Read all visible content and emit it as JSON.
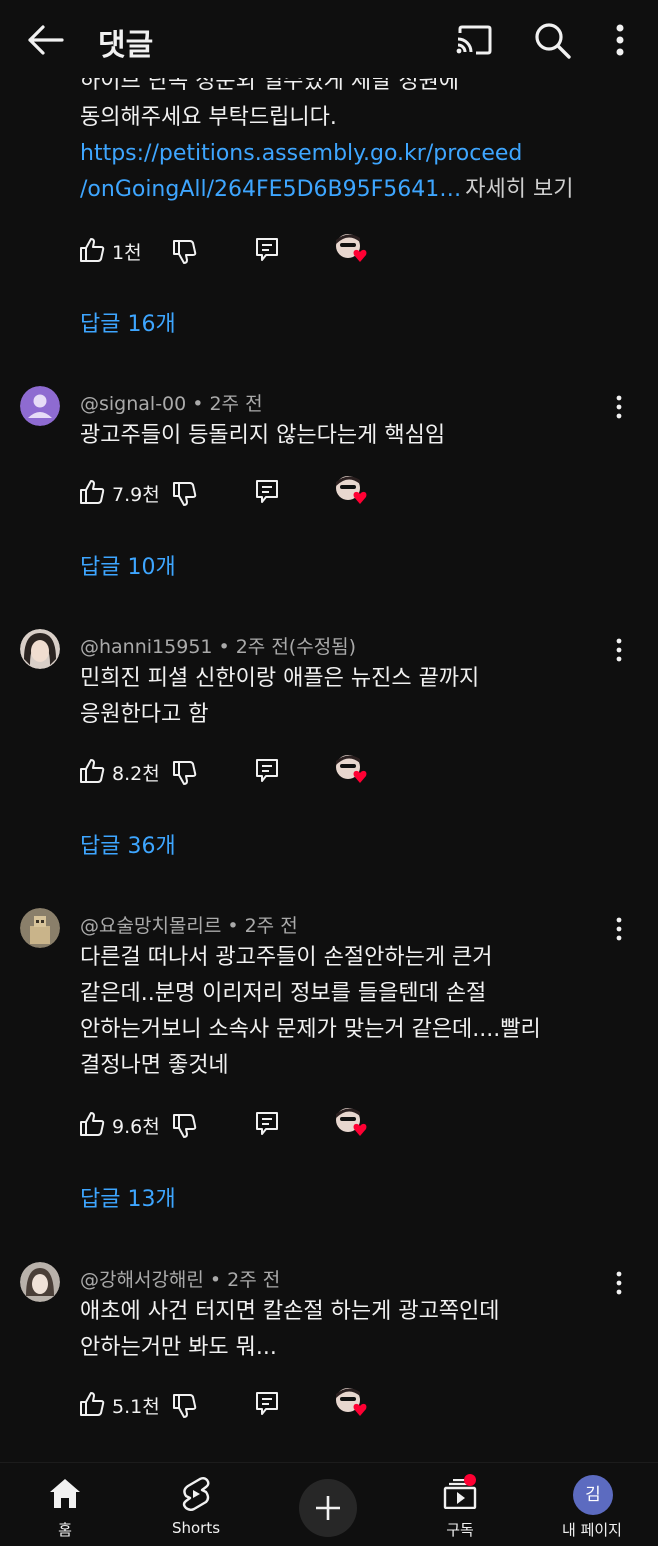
{
  "header": {
    "title": "댓글",
    "icons": [
      "back-arrow-icon",
      "cast-icon",
      "search-icon",
      "more-vert-icon"
    ]
  },
  "comments": [
    {
      "lines": [
        "하이브 단독 정문외 열수있게 세발 정원에",
        "동의해주세요 부탁드립니다."
      ],
      "link_lines": [
        "https://petitions.assembly.go.kr/proceed",
        "/onGoingAll/264FE5D6B95F5641…"
      ],
      "read_more": "자세히 보기",
      "likes": "1천",
      "replies": "답글 16개"
    },
    {
      "author": "@signal-00",
      "time": "2주 전",
      "lines": [
        "광고주들이 등돌리지 않는다는게 핵심임"
      ],
      "likes": "7.9천",
      "replies": "답글 10개"
    },
    {
      "author": "@hanni15951",
      "time": "2주 전(수정됨)",
      "lines": [
        "민희진 피셜 신한이랑 애플은 뉴진스 끝까지",
        "응원한다고 함"
      ],
      "likes": "8.2천",
      "replies": "답글 36개"
    },
    {
      "author": "@요술망치몰리르",
      "time": "2주 전",
      "lines": [
        "다른걸 떠나서 광고주들이 손절안하는게 큰거",
        "같은데..분명 이리저리 정보를 들을텐데 손절",
        "안하는거보니 소속사 문제가 맞는거 같은데....빨리",
        "결정나면 좋것네"
      ],
      "likes": "9.6천",
      "replies": "답글 13개"
    },
    {
      "author": "@강해서강해린",
      "time": "2주 전",
      "lines": [
        "애초에 사건 터지면 칼손절 하는게 광고쪽인데",
        "안하는거만 봐도 뭐..."
      ],
      "likes": "5.1천",
      "replies": ""
    }
  ],
  "bottom_nav": {
    "home": "홈",
    "shorts": "Shorts",
    "subscriptions": "구독",
    "me": "내 페이지",
    "me_initial": "김"
  },
  "colors": {
    "background": "#0f0f0f",
    "link": "#3ea6ff",
    "heart": "#ff0033",
    "me_avatar": "#5c6bc0"
  }
}
